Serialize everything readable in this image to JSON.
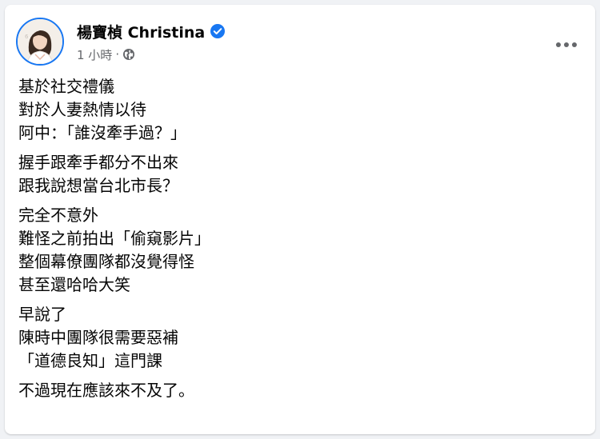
{
  "post": {
    "author": {
      "name": "楊寶楨 Christina",
      "verified": true,
      "avatar_icon": "profile-photo"
    },
    "meta": {
      "time": "1 小時",
      "separator": "·",
      "privacy_icon": "globe-icon"
    },
    "more_icon": "more-options-icon",
    "paragraphs": [
      [
        "基於社交禮儀",
        "對於人妻熱情以待",
        "阿中：「誰沒牽手過？」"
      ],
      [
        "握手跟牽手都分不出來",
        "跟我說想當台北市長？"
      ],
      [
        "完全不意外",
        "難怪之前拍出「偷窺影片」",
        "整個幕僚團隊都沒覺得怪",
        "甚至還哈哈大笑"
      ],
      [
        "早說了",
        "陳時中團隊很需要惡補",
        "「道德良知」這門課"
      ],
      [
        "不過現在應該來不及了。"
      ]
    ]
  },
  "colors": {
    "verified_blue": "#1877f2",
    "text_primary": "#050505",
    "text_secondary": "#65676b",
    "card_bg": "#ffffff",
    "page_bg": "#f0f2f5"
  }
}
